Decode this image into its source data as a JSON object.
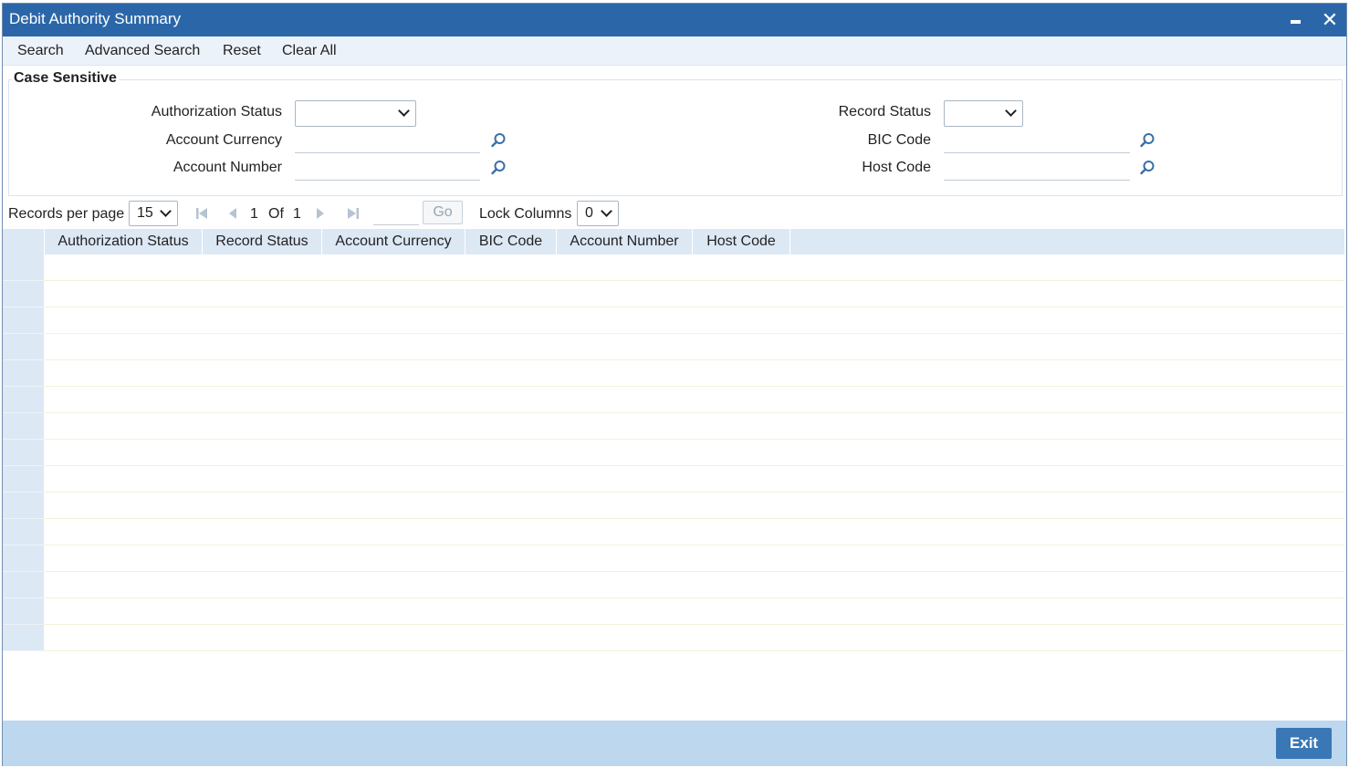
{
  "window": {
    "title": "Debit Authority Summary"
  },
  "toolbar": {
    "items": [
      "Search",
      "Advanced Search",
      "Reset",
      "Clear All"
    ]
  },
  "criteria": {
    "legend": "Case Sensitive",
    "authorization_status_label": "Authorization Status",
    "account_currency_label": "Account Currency",
    "account_number_label": "Account Number",
    "record_status_label": "Record Status",
    "bic_code_label": "BIC Code",
    "host_code_label": "Host Code",
    "authorization_status_value": "",
    "record_status_value": "",
    "account_currency_value": "",
    "account_number_value": "",
    "bic_code_value": "",
    "host_code_value": ""
  },
  "pager": {
    "records_per_page_label": "Records per page",
    "records_per_page_value": "15",
    "current_page": "1",
    "of_label": "Of",
    "total_pages": "1",
    "goto_value": "",
    "go_label": "Go",
    "lock_columns_label": "Lock Columns",
    "lock_columns_value": "0"
  },
  "grid": {
    "columns": [
      "Authorization Status",
      "Record Status",
      "Account Currency",
      "BIC Code",
      "Account Number",
      "Host Code"
    ],
    "row_count": 15
  },
  "footer": {
    "exit_label": "Exit"
  },
  "colors": {
    "titlebar": "#2b67a8",
    "toolbar": "#ecf2f9",
    "grid_header": "#dde8f5",
    "footer": "#bdd7ee",
    "exit_button": "#3a78b5"
  },
  "icons": {
    "lov": "magnifier-icon",
    "first": "first-page-icon",
    "prev": "previous-page-icon",
    "next": "next-page-icon",
    "last": "last-page-icon"
  }
}
